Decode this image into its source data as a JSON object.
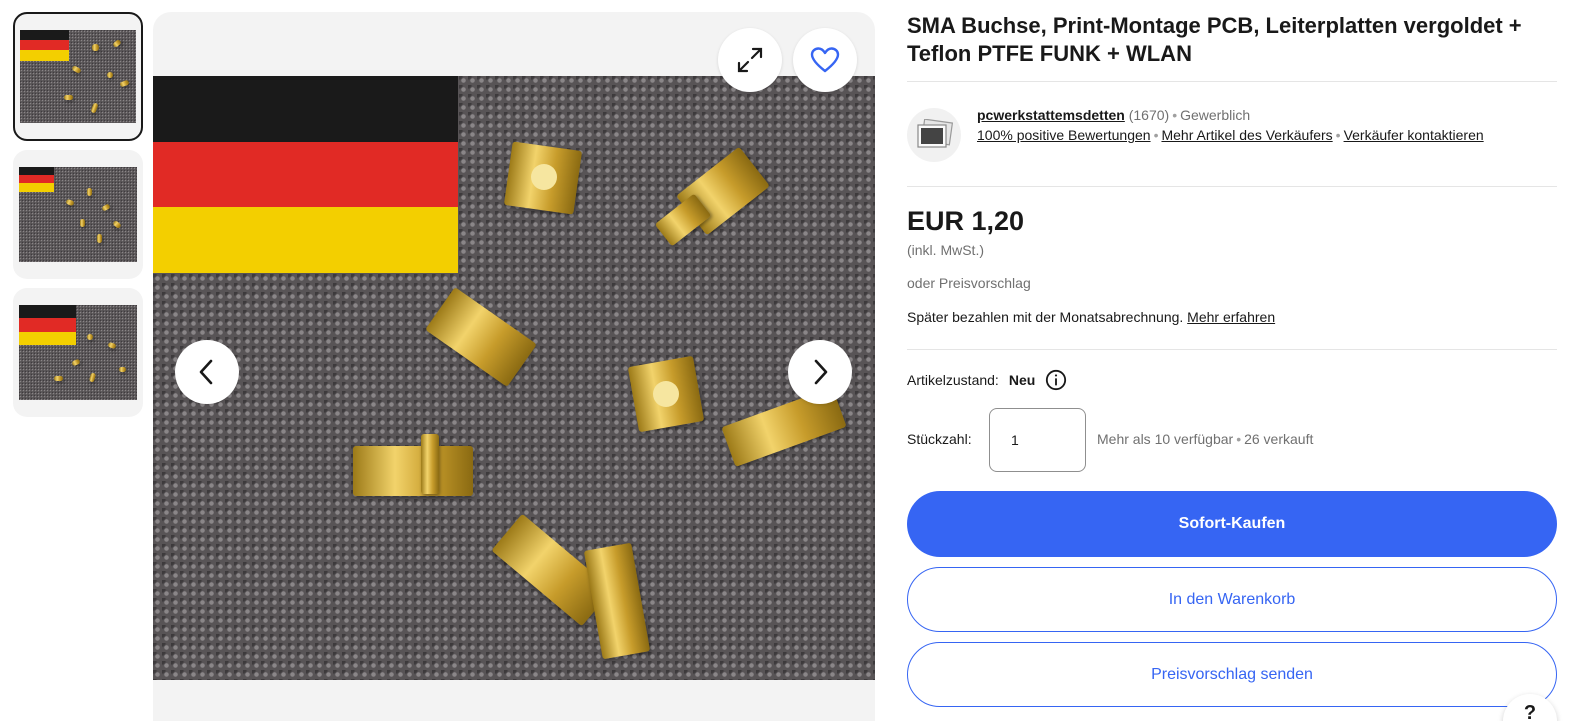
{
  "listing": {
    "title": "SMA Buchse, Print-Montage PCB, Leiterplatten vergoldet + Teflon PTFE FUNK + WLAN"
  },
  "gallery": {
    "thumbnails": [
      {
        "name": "thumbnail-1",
        "selected": true
      },
      {
        "name": "thumbnail-2",
        "selected": false
      },
      {
        "name": "thumbnail-3",
        "selected": false
      }
    ],
    "icons": {
      "expand": "expand-icon",
      "favorite": "heart-icon",
      "previous": "chevron-left-icon",
      "next": "chevron-right-icon"
    }
  },
  "seller": {
    "name": "pcwerkstattemsdetten",
    "feedback_count": "(1670)",
    "type": "Gewerblich",
    "positive_feedback": "100% positive Bewertungen",
    "more_items": "Mehr Artikel des Verkäufers",
    "contact": "Verkäufer kontaktieren"
  },
  "pricing": {
    "price": "EUR 1,20",
    "vat_note": "(inkl. MwSt.)",
    "best_offer": "oder Preisvorschlag",
    "pay_later_text": "Später bezahlen mit der Monatsabrechnung.",
    "pay_later_link": "Mehr erfahren"
  },
  "condition": {
    "label": "Artikelzustand:",
    "value": "Neu"
  },
  "quantity": {
    "label": "Stückzahl:",
    "value": "1",
    "available": "Mehr als 10 verfügbar",
    "sold": "26 verkauft"
  },
  "actions": {
    "buy_now": "Sofort-Kaufen",
    "add_to_cart": "In den Warenkorb",
    "make_offer": "Preisvorschlag senden"
  },
  "help": {
    "label": "?"
  },
  "colors": {
    "primary": "#3665f3",
    "text": "#191919",
    "muted": "#707070"
  }
}
